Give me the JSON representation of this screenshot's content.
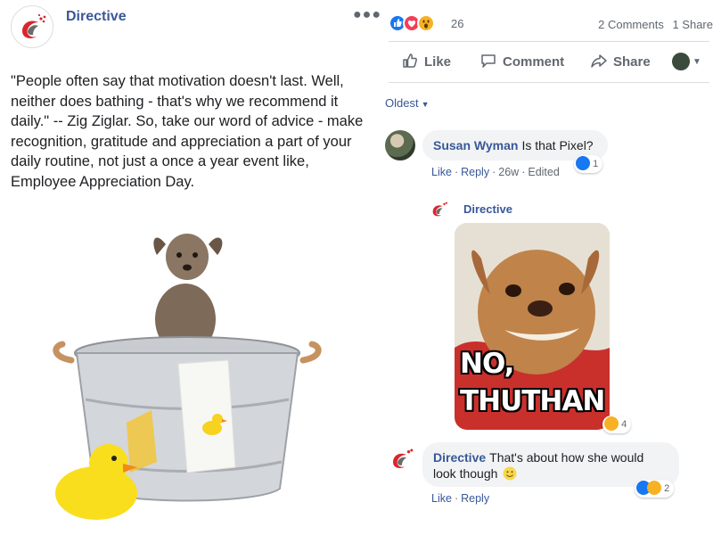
{
  "post": {
    "page_name": "Directive",
    "more_icon": "more-dots-icon",
    "text": "\"People often say that motivation doesn't last. Well, neither does bathing - that's why we recommend it daily.\" -- Zig Ziglar. So, take our word of advice - make recognition, gratitude and appreciation a part of your daily routine, not just a once a year event like, Employee Appreciation Day.",
    "image_icon": "dog-in-bathtub-photo"
  },
  "reactions": {
    "icons": [
      "like-icon",
      "love-icon",
      "wow-icon"
    ],
    "count": "26",
    "comments": "2 Comments",
    "shares": "1 Share"
  },
  "actions": {
    "like": "Like",
    "comment": "Comment",
    "share": "Share"
  },
  "sort": {
    "label": "Oldest"
  },
  "comments": [
    {
      "author": "Susan Wyman",
      "text": "Is that Pixel?",
      "like": "Like",
      "reply": "Reply",
      "time": "26w",
      "edited": "Edited",
      "reaction_count": "1"
    }
  ],
  "reply": {
    "author": "Directive",
    "meme_line1": "NO,",
    "meme_line2": "THUTHAN",
    "reaction_count": "4"
  },
  "comment2": {
    "author": "Directive",
    "text": "That's about how she would look though",
    "like": "Like",
    "reply": "Reply",
    "reaction_count": "2"
  },
  "colors": {
    "link": "#385898",
    "brand_red": "#d9262e",
    "like_blue": "#1877f2",
    "love_red": "#f33e58",
    "wow_yellow": "#f7b125"
  }
}
